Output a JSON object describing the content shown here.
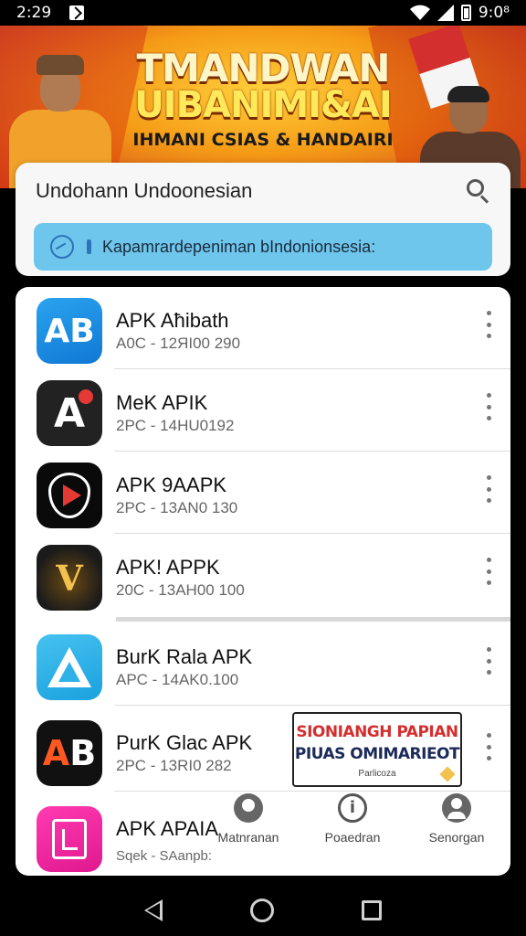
{
  "status_bar": {
    "time": "2:29",
    "right_time": "9:0⁸"
  },
  "banner": {
    "title_line1": "TMANDWAN",
    "title_line2": "UIBANIMI&AI",
    "subtitle": "IHMANI CSIAS & HANDAIRI"
  },
  "search": {
    "title": "Undohann Undoonesian",
    "field_text": "Kapamrardepeniman bIndonionsesia:"
  },
  "apps": [
    {
      "name": "APK Aħibath",
      "meta": "A0C - 12ЯI00 290",
      "icon": "ab-blue-icon"
    },
    {
      "name": "MeK APIK",
      "meta": "2PC - 14HU0192",
      "icon": "a-dark-icon"
    },
    {
      "name": "APK 9AAPK",
      "meta": "2PC - 13AN0 130",
      "icon": "play-shield-icon"
    },
    {
      "name": "APK! APPK",
      "meta": "20C - 13AH00 100",
      "icon": "v-gold-icon"
    },
    {
      "name": "BurK Rala APK",
      "meta": "APC - 14AK0.100",
      "icon": "a-light-icon"
    },
    {
      "name": "PurK Glac APK",
      "meta": "2PC - 13RI0 282",
      "icon": "ab-dark-icon"
    },
    {
      "name": "APK APAIA",
      "meta": "Sqek - SAanpb:",
      "icon": "pink-doc-icon"
    }
  ],
  "ad": {
    "line1": "SIONIANGH PAPIAN",
    "line2": "PIUAS OMIMARIEOT",
    "line3": "Parlicoza"
  },
  "tabs": [
    {
      "label": "Matnranan",
      "icon": "people-icon"
    },
    {
      "label": "Poaedran",
      "icon": "info-icon"
    },
    {
      "label": "Senorgan",
      "icon": "person-icon"
    }
  ],
  "colors": {
    "search_field": "#6ec6ec",
    "banner_accent": "#f59b16",
    "brand_red": "#d32f2f"
  }
}
